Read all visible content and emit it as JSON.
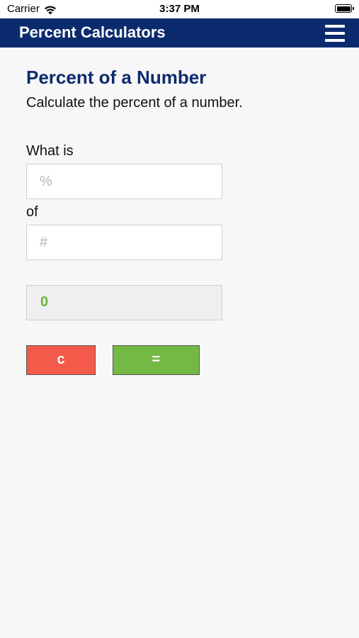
{
  "status_bar": {
    "carrier": "Carrier",
    "time": "3:37 PM",
    "wifi_icon": "wifi-icon",
    "battery_icon": "battery-icon"
  },
  "nav": {
    "title": "Percent Calculators",
    "menu_icon": "hamburger-menu-icon"
  },
  "calculator": {
    "title": "Percent of a Number",
    "subtitle": "Calculate the percent of a number.",
    "label_what_is": "What is",
    "percent_field": {
      "placeholder": "%",
      "value": ""
    },
    "label_of": "of",
    "number_field": {
      "placeholder": "#",
      "value": ""
    },
    "result": "0",
    "clear_label": "c",
    "equals_label": "="
  },
  "colors": {
    "nav_background": "#0c2b6e",
    "title_color": "#0c2b6e",
    "result_color": "#6cb33f",
    "clear_button": "#f45a4a",
    "equals_button": "#74b944",
    "page_background": "#f7f7f7"
  }
}
